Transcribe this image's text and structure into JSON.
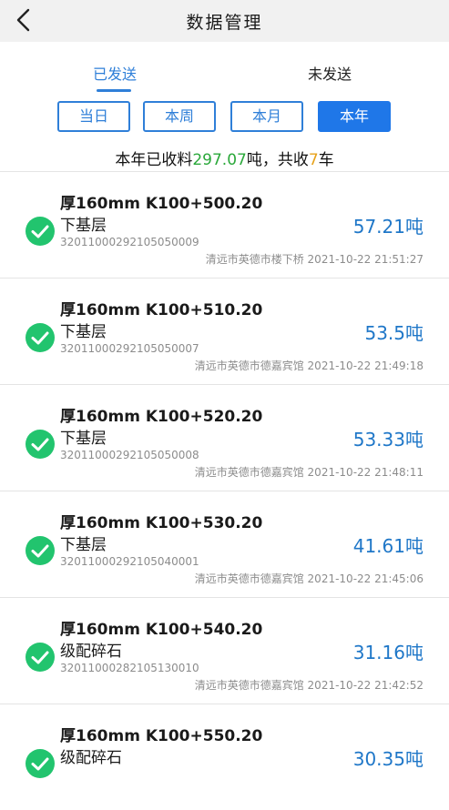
{
  "header": {
    "title": "数据管理",
    "back_icon": "chevron-left-icon"
  },
  "tabs": [
    {
      "label": "已发送",
      "active": true
    },
    {
      "label": "未发送",
      "active": false
    }
  ],
  "filters": [
    {
      "label": "当日",
      "active": false
    },
    {
      "label": "本周",
      "active": false
    },
    {
      "label": "本月",
      "active": false
    },
    {
      "label": "本年",
      "active": true
    }
  ],
  "summary": {
    "prefix": "本年已收料",
    "amount": "297.07",
    "mid": "吨，共收",
    "count": "7",
    "suffix": "车"
  },
  "colors": {
    "accent": "#1f77e8",
    "check": "#22c46e",
    "amount": "#2aa83a",
    "count": "#e7a21b",
    "weight": "#1f77c8"
  },
  "records": [
    {
      "title": "厚160mm K100+500.20",
      "layer": "下基层",
      "code": "32011000292105050009",
      "meta": "清远市英德市楼下桥 2021-10-22 21:51:27",
      "weight": "57.21吨",
      "icon": "check-circle-icon"
    },
    {
      "title": "厚160mm K100+510.20",
      "layer": "下基层",
      "code": "32011000292105050007",
      "meta": "清远市英德市德嘉宾馆 2021-10-22 21:49:18",
      "weight": "53.5吨",
      "icon": "check-circle-icon"
    },
    {
      "title": "厚160mm K100+520.20",
      "layer": "下基层",
      "code": "32011000292105050008",
      "meta": "清远市英德市德嘉宾馆 2021-10-22 21:48:11",
      "weight": "53.33吨",
      "icon": "check-circle-icon"
    },
    {
      "title": "厚160mm K100+530.20",
      "layer": "下基层",
      "code": "32011000292105040001",
      "meta": "清远市英德市德嘉宾馆 2021-10-22 21:45:06",
      "weight": "41.61吨",
      "icon": "check-circle-icon"
    },
    {
      "title": "厚160mm K100+540.20",
      "layer": "级配碎石",
      "code": "32011000282105130010",
      "meta": "清远市英德市德嘉宾馆 2021-10-22 21:42:52",
      "weight": "31.16吨",
      "icon": "check-circle-icon"
    },
    {
      "title": "厚160mm K100+550.20",
      "layer": "级配碎石",
      "code": "",
      "meta": "",
      "weight": "30.35吨",
      "icon": "check-circle-icon"
    }
  ]
}
